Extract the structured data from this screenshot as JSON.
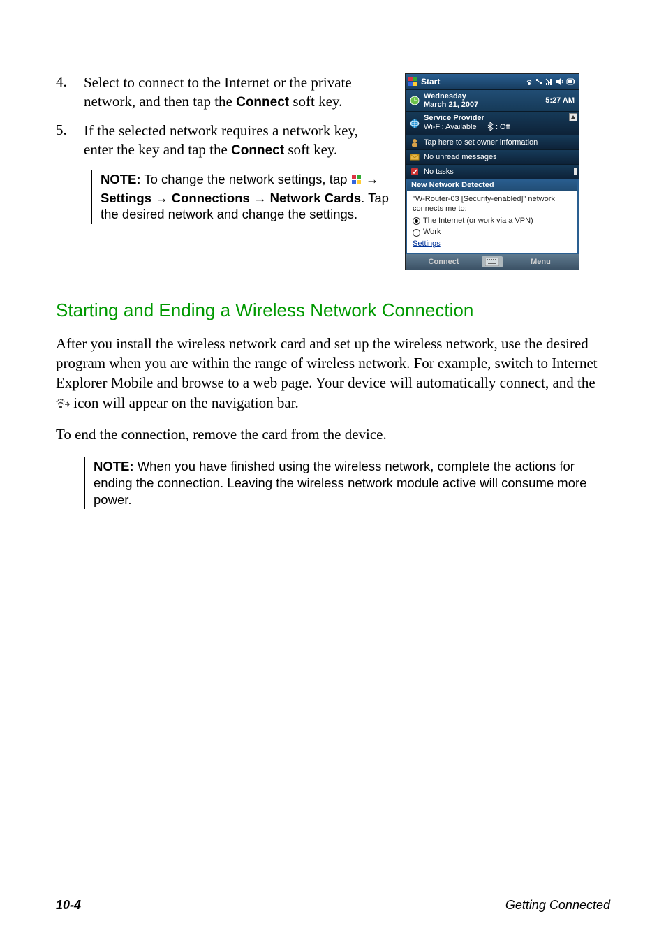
{
  "steps": {
    "s4_num": "4.",
    "s4_text_a": "Select to connect to the Internet or the private network, and then tap the ",
    "s4_bold": "Connect",
    "s4_text_b": " soft key.",
    "s5_num": "5.",
    "s5_text_a": "If the selected network requires a network key, enter the key and tap the ",
    "s5_bold": "Connect",
    "s5_text_b": " soft key."
  },
  "note1": {
    "prefix": "NOTE:",
    "part1": " To change the network settings, tap ",
    "arrow": "→",
    "settings": "Settings",
    "connections": "Connections",
    "network_cards": "Network Cards",
    "part2": ". Tap the desired network and change the settings."
  },
  "section_heading": "Starting and Ending a Wireless Network Connection",
  "body1_a": "After you install the wireless network card and set up the wireless network, use the desired program when you are within the range of wireless network. For example, switch to Internet Explorer Mobile and browse to a web page. Your device will automatically connect, and the ",
  "body1_b": " icon will appear on the navigation bar.",
  "body2": "To end the connection, remove the card from the device.",
  "note2": {
    "prefix": "NOTE:",
    "text": " When you have finished using the wireless network, complete the actions for ending the connection. Leaving the wireless network module active will consume more power."
  },
  "footer": {
    "page": "10-4",
    "title": "Getting Connected"
  },
  "device": {
    "start": "Start",
    "day": "Wednesday",
    "date": "March 21, 2007",
    "time": "5:27 AM",
    "provider": "Service Provider",
    "wifi": "Wi-Fi: Available",
    "bt_off": " : Off",
    "owner": "Tap here to set owner information",
    "unread": "No unread messages",
    "tasks": "No tasks",
    "popup_title": "New Network Detected",
    "popup_line": "\"W-Router-03 [Security-enabled]\" network connects me to:",
    "radio1": "The Internet (or work via a VPN)",
    "radio2": "Work",
    "settings_link": "Settings",
    "sk_connect": "Connect",
    "sk_menu": "Menu"
  }
}
